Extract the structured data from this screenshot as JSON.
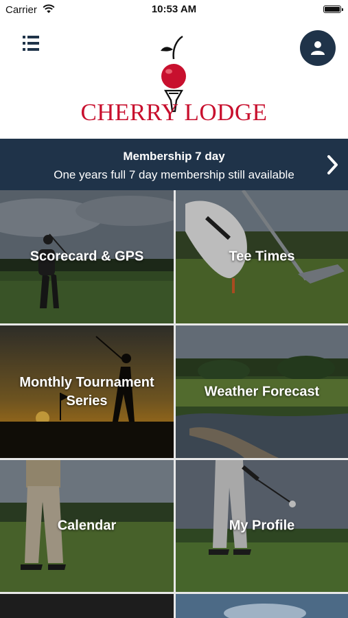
{
  "status_bar": {
    "carrier": "Carrier",
    "time": "10:53 AM"
  },
  "header": {
    "logo_text": "CHERRY LODGE",
    "brand_color": "#c8102e",
    "menu_icon": "list-menu-icon",
    "profile_icon": "user-icon"
  },
  "banner": {
    "title": "Membership 7 day",
    "subtitle": "One years full 7 day membership still available",
    "background": "#1f3349"
  },
  "tiles": [
    {
      "label": "Scorecard & GPS"
    },
    {
      "label": "Tee Times"
    },
    {
      "label": "Monthly Tournament Series"
    },
    {
      "label": "Weather Forecast"
    },
    {
      "label": "Calendar"
    },
    {
      "label": "My Profile"
    }
  ]
}
